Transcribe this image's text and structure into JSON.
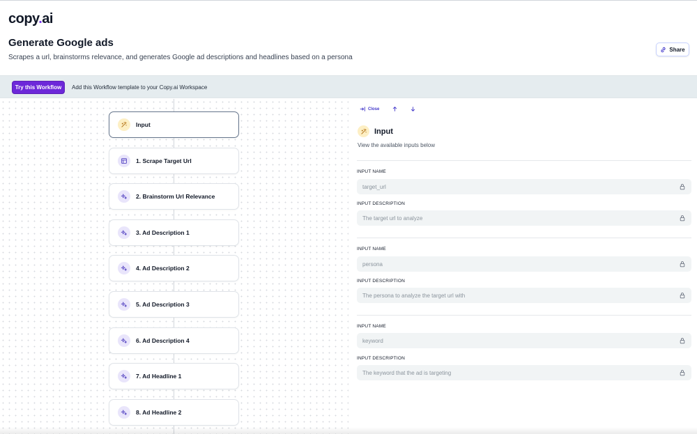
{
  "brand": {
    "name_main": "copy",
    "name_dot": ".",
    "name_tld": "ai"
  },
  "header": {
    "title": "Generate Google ads",
    "subtitle": "Scrapes a url, brainstorms relevance, and generates Google ad descriptions and headlines based on a persona",
    "share_label": "Share"
  },
  "banner": {
    "try_label": "Try this Workflow",
    "text": "Add this Workflow template to your Copy.ai Workspace"
  },
  "workflow": {
    "steps": [
      {
        "label": "Input",
        "icon": "wand-icon"
      },
      {
        "label": "1. Scrape Target Url",
        "icon": "layout-icon"
      },
      {
        "label": "2. Brainstorm Url Relevance",
        "icon": "sparkle-icon"
      },
      {
        "label": "3. Ad Description 1",
        "icon": "sparkle-icon"
      },
      {
        "label": "4. Ad Description 2",
        "icon": "sparkle-icon"
      },
      {
        "label": "5. Ad Description 3",
        "icon": "sparkle-icon"
      },
      {
        "label": "6. Ad Description 4",
        "icon": "sparkle-icon"
      },
      {
        "label": "7. Ad Headline 1",
        "icon": "sparkle-icon"
      },
      {
        "label": "8. Ad Headline 2",
        "icon": "sparkle-icon"
      }
    ]
  },
  "panel": {
    "close_label": "Close",
    "title": "Input",
    "subtitle": "View the available inputs below",
    "name_label": "INPUT NAME",
    "desc_label": "INPUT DESCRIPTION",
    "inputs": [
      {
        "name": "target_url",
        "description": "The target url to analyze"
      },
      {
        "name": "persona",
        "description": "The persona to analyze the target url with"
      },
      {
        "name": "keyword",
        "description": "The keyword that the ad is targeting"
      }
    ]
  },
  "colors": {
    "accent": "#6d28d9",
    "banner_bg": "#e5ecef",
    "icon_purple_bg": "#e9e5fb",
    "icon_yellow_bg": "#fdefc4"
  }
}
